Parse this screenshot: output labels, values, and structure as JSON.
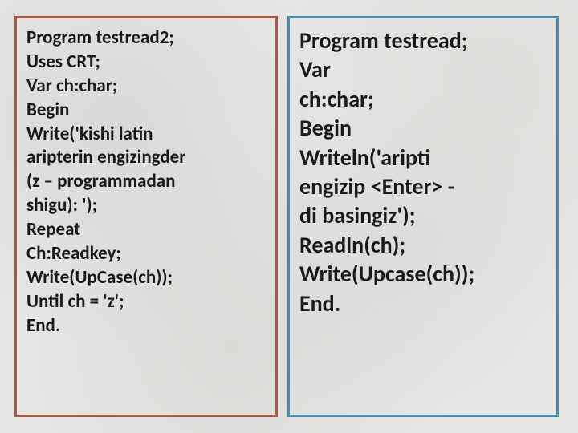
{
  "left_box": {
    "lines": [
      "Program testread2;",
      "Uses CRT;",
      "Var ch:char;",
      "Begin",
      "Write('kishi latin",
      "aripterin engizingder",
      "(z – programmadan",
      "shigu): ');",
      "Repeat",
      "Ch:Readkey;",
      "Write(UpCase(ch));",
      "Until ch = 'z';",
      "End."
    ]
  },
  "right_box": {
    "lines": [
      "Program testread;",
      "Var",
      "ch:char;",
      "Begin",
      "Writeln('aripti",
      "engizip <Enter> -",
      "di basingiz');",
      "Readln(ch);",
      "Write(Upcase(ch));",
      "End."
    ]
  }
}
